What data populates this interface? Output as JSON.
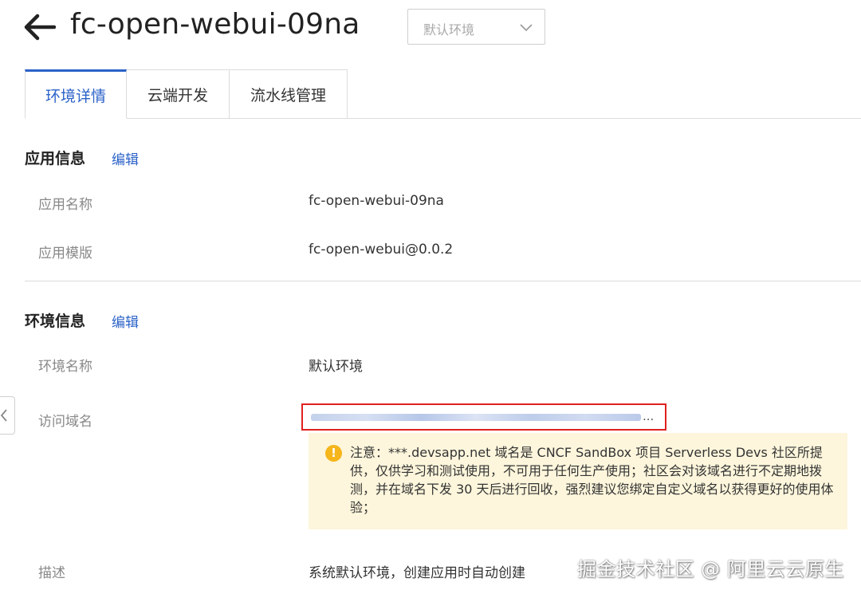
{
  "header": {
    "title": "fc-open-webui-09na",
    "env_select": {
      "value": "默认环境"
    }
  },
  "tabs": [
    {
      "label": "环境详情",
      "active": true
    },
    {
      "label": "云端开发",
      "active": false
    },
    {
      "label": "流水线管理",
      "active": false
    }
  ],
  "app_info": {
    "title": "应用信息",
    "edit_label": "编辑",
    "fields": [
      {
        "label": "应用名称",
        "value": "fc-open-webui-09na"
      },
      {
        "label": "应用模版",
        "value": "fc-open-webui@0.0.2"
      }
    ]
  },
  "env_info": {
    "title": "环境信息",
    "edit_label": "编辑",
    "env_name_label": "环境名称",
    "env_name_value": "默认环境",
    "domain_label": "访问域名",
    "domain_ellipsis": "...",
    "notice": "注意：***.devsapp.net 域名是 CNCF SandBox 项目 Serverless Devs 社区所提供，仅供学习和测试使用，不可用于任何生产使用；社区会对该域名进行不定期地拨测，并在域名下发 30 天后进行回收，强烈建议您绑定自定义域名以获得更好的使用体验；",
    "desc_label": "描述",
    "desc_value": "系统默认环境，创建应用时自动创建"
  },
  "watermark": "掘金技术社区 @ 阿里云云原生",
  "colors": {
    "accent": "#2b62c8",
    "highlight_border": "#e02020",
    "notice_bg": "#fdf6dc",
    "warning_icon": "#f5b51b"
  }
}
